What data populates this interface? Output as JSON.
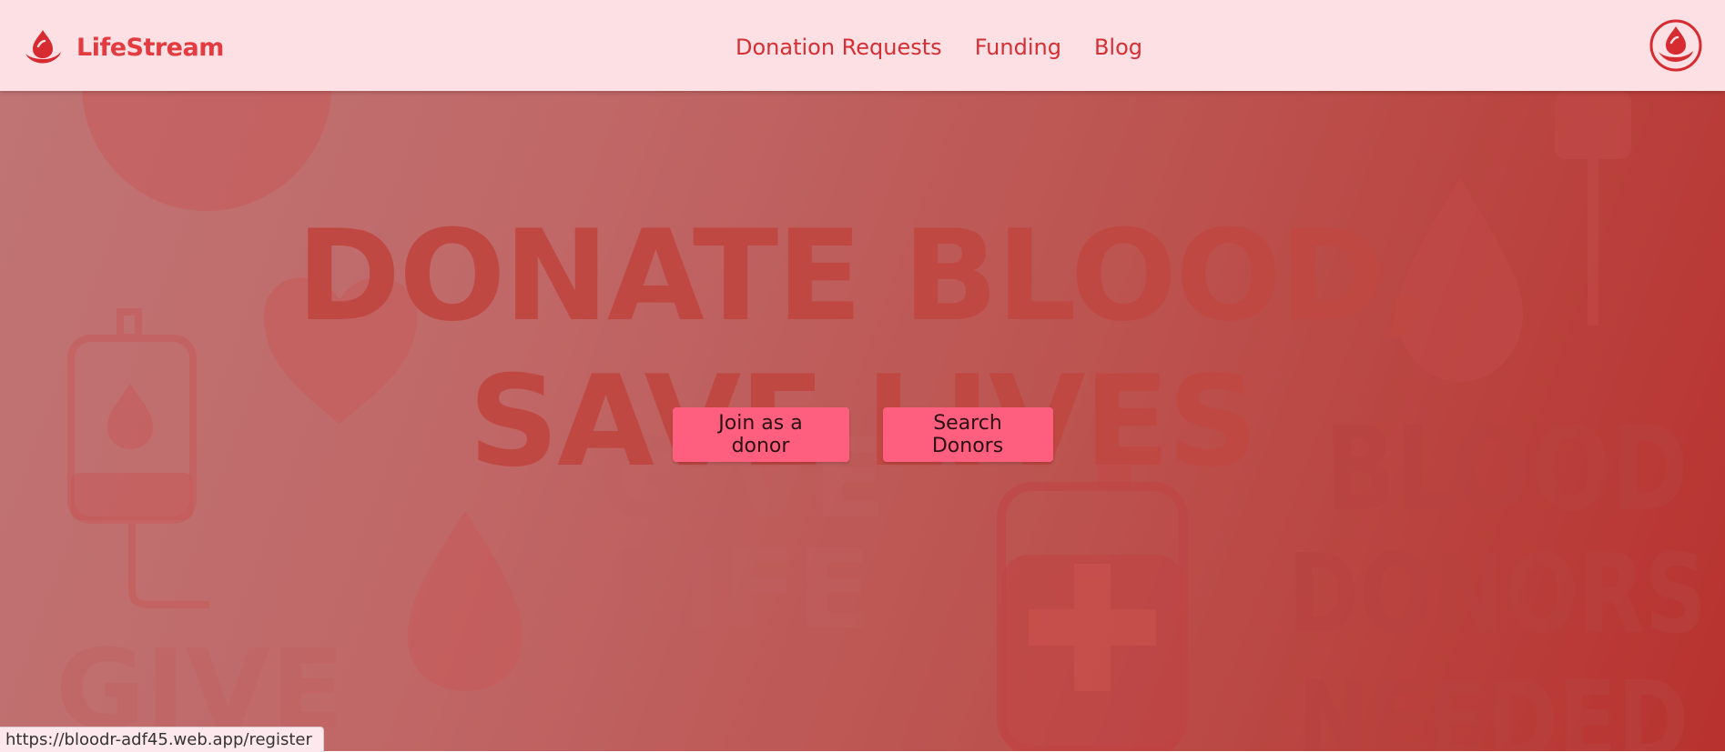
{
  "brand": {
    "name": "LifeStream",
    "logo_icon": "blood-drop-hand-icon"
  },
  "nav": {
    "links": [
      "Donation Requests",
      "Funding",
      "Blog"
    ]
  },
  "user": {
    "avatar_icon": "user-avatar-icon"
  },
  "hero": {
    "headline_line1": "DONATE BLOOD,",
    "headline_line2": "SAVE LIVES",
    "join_label": "Join as a donor",
    "search_label": "Search Donors",
    "bg_text_give_life_1": "GIVE",
    "bg_text_give_life_2": "LIFE",
    "bg_text_blood": "BLOOD",
    "bg_text_donors": "DONORS",
    "bg_text_needed": "NEEDED",
    "bg_text_give_bottom": "GIVE"
  },
  "status_bar": {
    "url": "https://bloodr-adf45.web.app/register"
  },
  "colors": {
    "nav_bg": "#fde0e3",
    "brand_red": "#e23b40",
    "cta_pink": "#ff5f7e",
    "hero_start": "#c07474",
    "hero_end": "#b8322f"
  }
}
